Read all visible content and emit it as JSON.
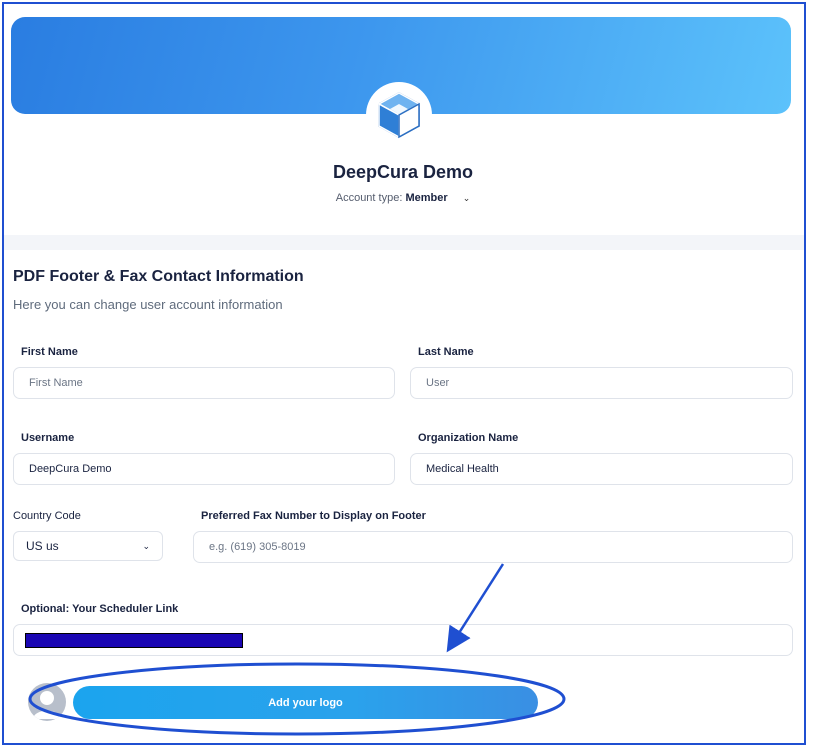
{
  "profile": {
    "org_name": "DeepCura Demo",
    "account_type_label": "Account type:",
    "account_type_value": "Member",
    "logo_icon": "cube-icon",
    "chevron_icon": "chevron-down-icon"
  },
  "section": {
    "title": "PDF Footer & Fax Contact Information",
    "subtitle": "Here you can change user account information"
  },
  "form": {
    "first_name": {
      "label": "First Name",
      "placeholder": "First Name",
      "value": ""
    },
    "last_name": {
      "label": "Last Name",
      "placeholder": "User",
      "value": ""
    },
    "username": {
      "label": "Username",
      "value": "DeepCura Demo"
    },
    "organization": {
      "label": "Organization Name",
      "value": "Medical Health"
    },
    "country_code": {
      "label": "Country Code",
      "value": "US us"
    },
    "fax": {
      "label": "Preferred Fax Number to Display on Footer",
      "placeholder": "e.g. (619) 305-8019",
      "value": ""
    },
    "scheduler": {
      "label": "Optional: Your Scheduler Link",
      "value": ""
    }
  },
  "logo_upload": {
    "button_label": "Add your logo",
    "avatar_icon": "user-avatar-icon"
  },
  "colors": {
    "banner_start": "#2a7de1",
    "banner_end": "#5cc2fb",
    "button": "#1ba4ee",
    "annotation": "#1f4fd1",
    "redaction": "#1a06b3"
  }
}
